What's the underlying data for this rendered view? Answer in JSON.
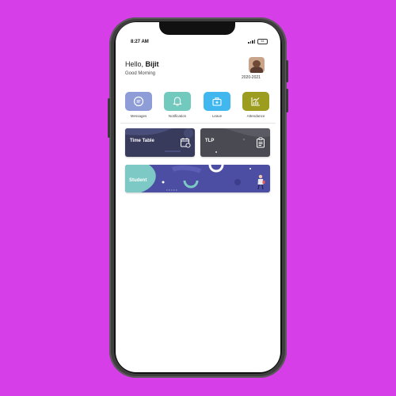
{
  "status": {
    "time": "8:27 AM",
    "battery": "64"
  },
  "header": {
    "hello": "Hello,",
    "name": "Bijit",
    "greeting": "Good Morning",
    "year": "2020-2021"
  },
  "quick_actions": [
    {
      "label": "Messages",
      "icon": "message-icon",
      "color": "#8e9cd8"
    },
    {
      "label": "Notification",
      "icon": "bell-icon",
      "color": "#72c9bd"
    },
    {
      "label": "Leave",
      "icon": "briefcase-icon",
      "color": "#40b8ef"
    },
    {
      "label": "Attendance",
      "icon": "chart-icon",
      "color": "#9c9c1e"
    }
  ],
  "cards": [
    {
      "label": "Time Table",
      "icon": "calendar-icon"
    },
    {
      "label": "TLP",
      "icon": "clipboard-icon"
    },
    {
      "label": "Student",
      "icon": "student-figure-icon"
    }
  ],
  "colors": {
    "background": "#d63fe8",
    "card_dark": "#393b5c",
    "card_gray": "#4a4a52",
    "card_purple": "#4c4ea3",
    "student_teal": "#7cc9c5"
  }
}
